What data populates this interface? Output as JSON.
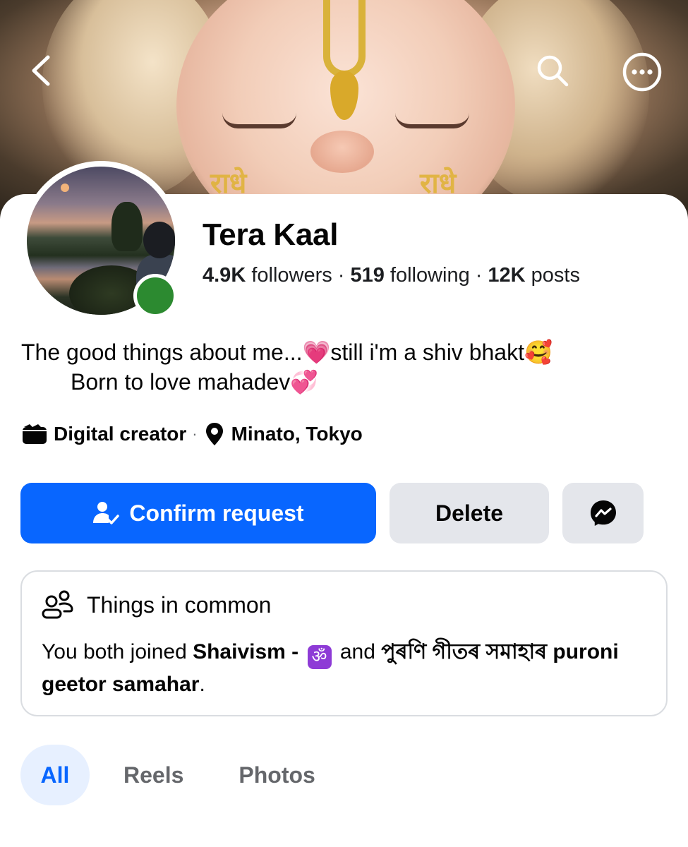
{
  "profile": {
    "name": "Tera Kaal",
    "followers_count": "4.9K",
    "followers_label": "followers",
    "following_count": "519",
    "following_label": "following",
    "posts_count": "12K",
    "posts_label": "posts",
    "online_status_color": "#2c8a30"
  },
  "cover": {
    "cheek_text_left": "राधे",
    "cheek_text_right": "राधे"
  },
  "bio": {
    "line1": "The good things about me...💗still i'm a shiv bhakt🥰",
    "line2": "Born to love mahadev💞"
  },
  "meta": {
    "category": "Digital creator",
    "separator": "·",
    "location": "Minato, Tokyo"
  },
  "actions": {
    "confirm_label": "Confirm request",
    "delete_label": "Delete",
    "accent_color": "#0866ff"
  },
  "common": {
    "title": "Things in common",
    "text_prefix": "You both joined ",
    "group1": "Shaivism  - ",
    "group1_emoji": "ॐ",
    "text_and": " and ",
    "group2": "পুৰণি গীতৰ সমাহাৰ puroni geetor samahar",
    "text_suffix": "."
  },
  "tabs": [
    {
      "label": "All",
      "active": true
    },
    {
      "label": "Reels",
      "active": false
    },
    {
      "label": "Photos",
      "active": false
    }
  ]
}
